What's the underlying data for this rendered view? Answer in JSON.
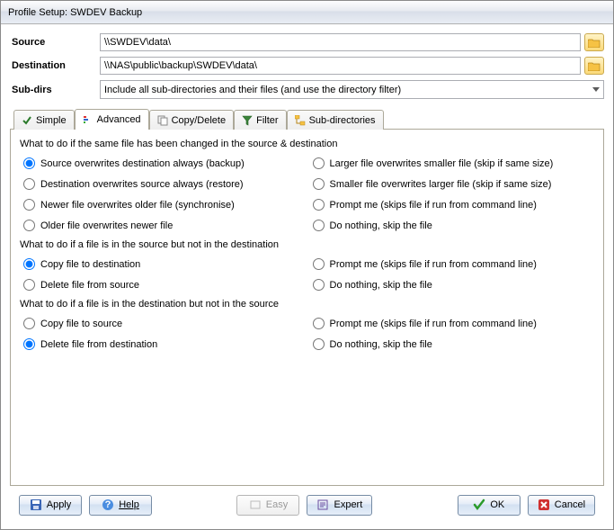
{
  "window": {
    "title": "Profile Setup: SWDEV Backup"
  },
  "fields": {
    "source": {
      "label": "Source",
      "value": "\\\\SWDEV\\data\\"
    },
    "destination": {
      "label": "Destination",
      "value": "\\\\NAS\\public\\backup\\SWDEV\\data\\"
    },
    "subdirs": {
      "label": "Sub-dirs",
      "value": "Include all sub-directories and their files (and use the directory filter)"
    }
  },
  "tabs": [
    {
      "label": "Simple"
    },
    {
      "label": "Advanced"
    },
    {
      "label": "Copy/Delete"
    },
    {
      "label": "Filter"
    },
    {
      "label": "Sub-directories"
    }
  ],
  "sections": {
    "conflict": {
      "heading": "What to do if the same file has been changed in the source & destination",
      "options": [
        "Source overwrites destination always (backup)",
        "Destination overwrites source always (restore)",
        "Newer file overwrites older file (synchronise)",
        "Older file overwrites newer file",
        "Larger file overwrites smaller file (skip if same size)",
        "Smaller file overwrites larger file (skip if same size)",
        "Prompt me (skips file if run from command line)",
        "Do nothing, skip the file"
      ],
      "selected": 0
    },
    "sourceOnly": {
      "heading": "What to do if a file is in the source but not in the destination",
      "options": [
        "Copy file to destination",
        "Delete file from source",
        "Prompt me  (skips file if run from command line)",
        "Do nothing, skip the file"
      ],
      "selected": 0
    },
    "destOnly": {
      "heading": "What to do if a file is in the destination but not in the source",
      "options": [
        "Copy file to source",
        "Delete file from destination",
        "Prompt me  (skips file if run from command line)",
        "Do nothing, skip the file"
      ],
      "selected": 1
    }
  },
  "buttons": {
    "apply": "Apply",
    "help": "Help",
    "easy": "Easy",
    "expert": "Expert",
    "ok": "OK",
    "cancel": "Cancel"
  }
}
